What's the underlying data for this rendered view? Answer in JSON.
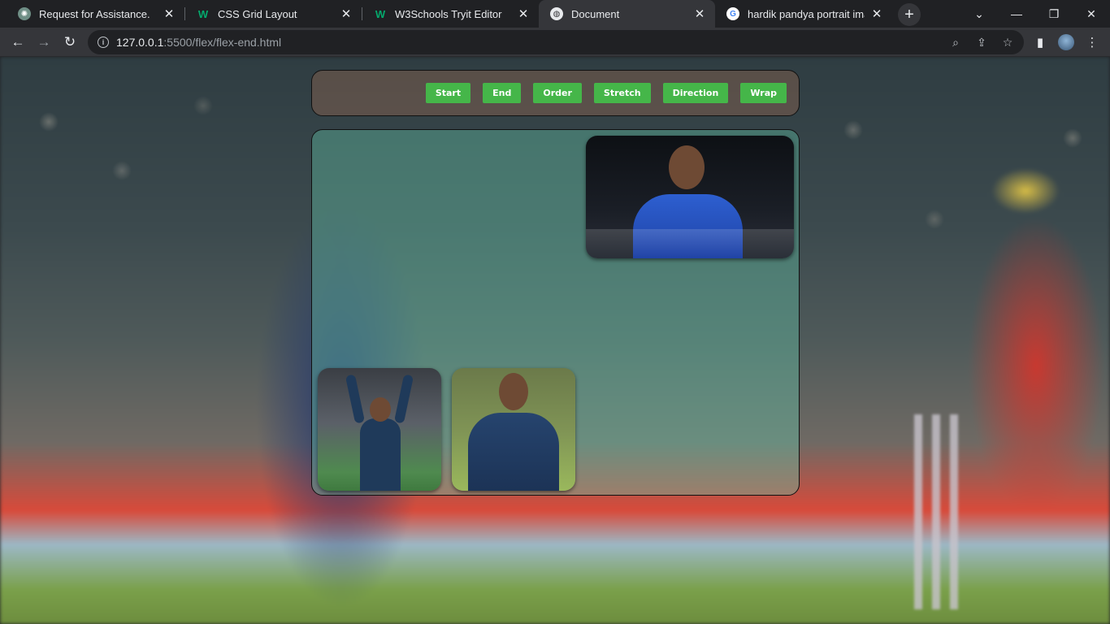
{
  "tabs": [
    {
      "title": "Request for Assistance.",
      "favicon": "chatgpt-icon"
    },
    {
      "title": "CSS Grid Layout",
      "favicon": "w3schools-icon"
    },
    {
      "title": "W3Schools Tryit Editor",
      "favicon": "w3schools-icon"
    },
    {
      "title": "Document",
      "favicon": "globe-icon",
      "active": true
    },
    {
      "title": "hardik pandya portrait image",
      "favicon": "google-icon"
    }
  ],
  "toolbar": {
    "url_host": "127.0.0.1",
    "url_path": ":5500/flex/flex-end.html"
  },
  "nav": {
    "buttons": [
      "Start",
      "End",
      "Order",
      "Stretch",
      "Direction",
      "Wrap"
    ]
  },
  "colors": {
    "button_bg": "#45b649",
    "card_border": "#111111",
    "chrome_dark": "#202124",
    "chrome_toolbar": "#35363a"
  }
}
